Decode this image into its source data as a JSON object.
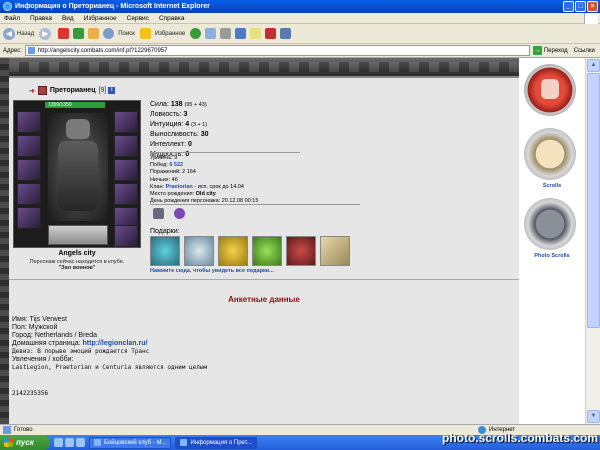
{
  "window": {
    "title": "Информация о Преторианец - Microsoft Internet Explorer"
  },
  "menu": [
    "Файл",
    "Правка",
    "Вид",
    "Избранное",
    "Сервис",
    "Справка"
  ],
  "toolbar": {
    "back": "Назад",
    "search": "Поиск",
    "favorites": "Избранное"
  },
  "address": {
    "label": "Адрес:",
    "url": "http://angelscity.combats.com/inf.pl?1229670957",
    "go": "Переход",
    "links": "Ссылки"
  },
  "character": {
    "name": "Преторианец",
    "level": "[9]",
    "hp": "1359/1359",
    "city": "Angels city",
    "location_line1": "Персонаж сейчас находится в клубе.",
    "location_line2": "\"Зал воинов\""
  },
  "stats": [
    {
      "label": "Сила:",
      "value": "138",
      "mod": "(95 + 43)"
    },
    {
      "label": "Ловкость:",
      "value": "3",
      "mod": ""
    },
    {
      "label": "Интуиция:",
      "value": "4",
      "mod": "(3 + 1)"
    },
    {
      "label": "Выносливость:",
      "value": "30",
      "mod": ""
    },
    {
      "label": "Интеллект:",
      "value": "0",
      "mod": ""
    },
    {
      "label": "Мудрость:",
      "value": "0",
      "mod": ""
    }
  ],
  "details": {
    "level": "Уровень: 9",
    "wins_label": "Побед:",
    "wins": "6 522",
    "losses": "Поражений: 2 164",
    "draws": "Ничьих: 46",
    "clan_label": "Клан:",
    "clan": "Praetorian",
    "clan_rest": "- исп. срок до 14.04",
    "birthplace_label": "Место рождения:",
    "birthplace": "Old city",
    "birthday": "День рождения персонажа: 20.12.08 00:15"
  },
  "gifts": {
    "label": "Подарки:",
    "link": "Нажмите сюда, чтобы увидеть все подарки..."
  },
  "anketa": {
    "title": "Анкетные данные",
    "name": "Имя: Tijs Verwest",
    "gender": "Пол: Мужской",
    "city": "Город: Netherlands / Breda",
    "homepage_label": "Домашняя страница:",
    "homepage": "http://legionclan.ru/",
    "motto": "Девиз: В порыве эмоций рождается Транс",
    "hobbies_label": "Увлечения / хобби:",
    "hobbies": "LastLegion, Praetorian и Centuria являются одним целым",
    "number": "2142235356"
  },
  "sidebar": {
    "scrolls": "Scrolls",
    "photo_scrolls": "Photo Scrolls"
  },
  "status": {
    "left": "Готово",
    "zone": "Интернет"
  },
  "taskbar": {
    "start": "пуск",
    "tasks": [
      "Бойцовский клуб - М...",
      "Информация о Прет..."
    ]
  },
  "watermark": "photo.scrolls.combats.com"
}
